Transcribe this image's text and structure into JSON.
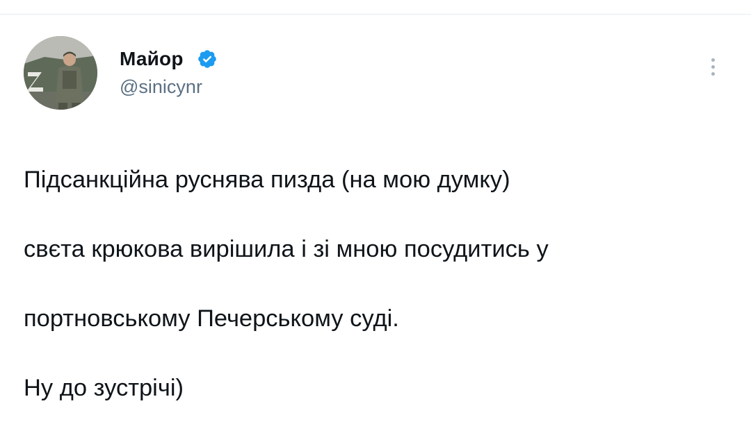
{
  "tweet": {
    "author": {
      "display_name": "Майор",
      "handle": "@sinicynr",
      "verified": true
    },
    "text_lines": [
      "Підсанкційна руснява пизда (на мою думку)",
      "свєта крюкова вирішила і зі мною посудитись у",
      "портновському Печерському суді.",
      "Ну до зустрічі)"
    ]
  },
  "colors": {
    "verified_badge": "#1d9bf0",
    "handle_text": "#5b7083",
    "body_text": "#0f1419",
    "menu_dots": "#a7b4bf"
  },
  "icons": {
    "verified": "verified-badge-icon",
    "more": "more-vertical-icon"
  }
}
